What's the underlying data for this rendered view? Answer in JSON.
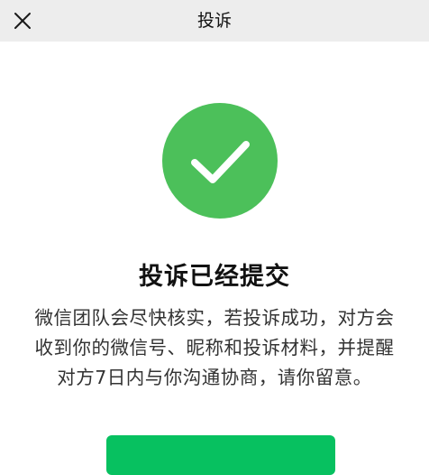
{
  "nav": {
    "title": "投诉",
    "close_icon": "close-icon"
  },
  "result": {
    "icon": "success-check-icon",
    "title": "投诉已经提交",
    "description_lines": [
      "微信团队会尽快核实，若投诉成功，对方会",
      "收到你的微信号、昵称和投诉材料，并提醒",
      "对方7日内与你沟通协商，请你留意。"
    ]
  },
  "colors": {
    "brand_green": "#07c160",
    "success_green": "#4cc05a",
    "nav_background": "#ededed"
  }
}
